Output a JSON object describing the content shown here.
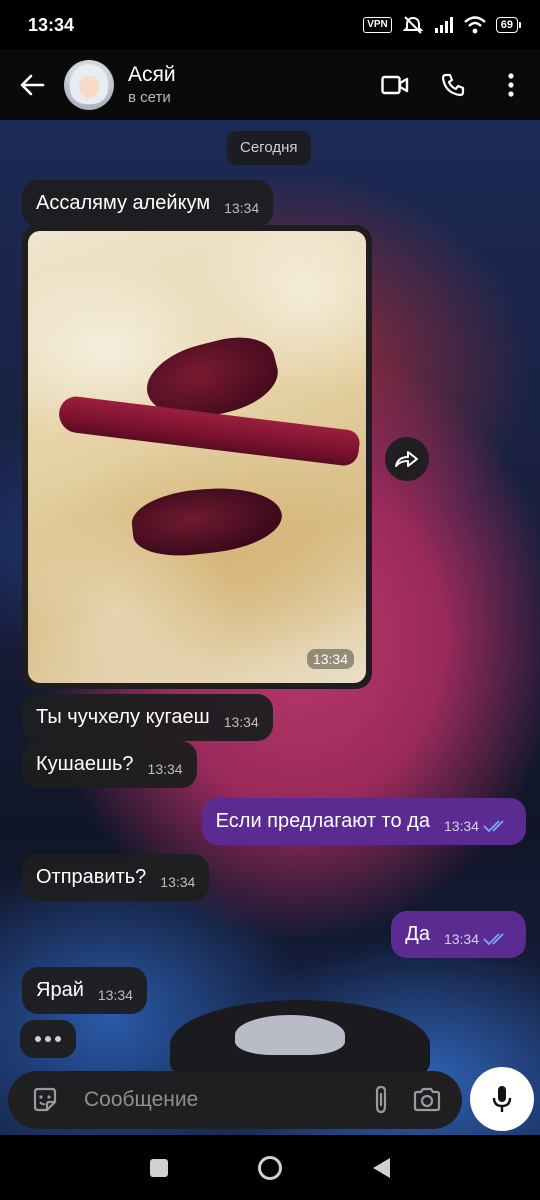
{
  "status_bar": {
    "time": "13:34",
    "vpn": "VPN",
    "battery": "69"
  },
  "header": {
    "contact_name": "Асяй",
    "contact_status": "в сети",
    "back_icon": "arrow-left-icon",
    "video_icon": "video-call-icon",
    "call_icon": "phone-icon",
    "menu_icon": "more-vertical-icon"
  },
  "chat": {
    "date_label": "Сегодня",
    "messages": [
      {
        "direction": "in",
        "text": "Ассаляму алейкум",
        "time": "13:34"
      },
      {
        "direction": "in",
        "type": "photo",
        "time": "13:34"
      },
      {
        "direction": "in",
        "text": "Ты чучхелу кугаеш",
        "time": "13:34"
      },
      {
        "direction": "in",
        "text": "Кушаешь?",
        "time": "13:34"
      },
      {
        "direction": "out",
        "text": "Если предлагают то да",
        "time": "13:34",
        "read": true
      },
      {
        "direction": "in",
        "text": "Отправить?",
        "time": "13:34"
      },
      {
        "direction": "out",
        "text": "Да",
        "time": "13:34",
        "read": true
      },
      {
        "direction": "in",
        "text": "Ярай",
        "time": "13:34"
      }
    ]
  },
  "composer": {
    "placeholder": "Сообщение",
    "sticker_icon": "sticker-icon",
    "attach_icon": "paperclip-icon",
    "camera_icon": "camera-icon",
    "mic_icon": "microphone-icon"
  },
  "colors": {
    "outgoing_bubble": "#5b2b92",
    "incoming_bubble": "#1e1e20",
    "read_ticks": "#7aa7ff"
  }
}
